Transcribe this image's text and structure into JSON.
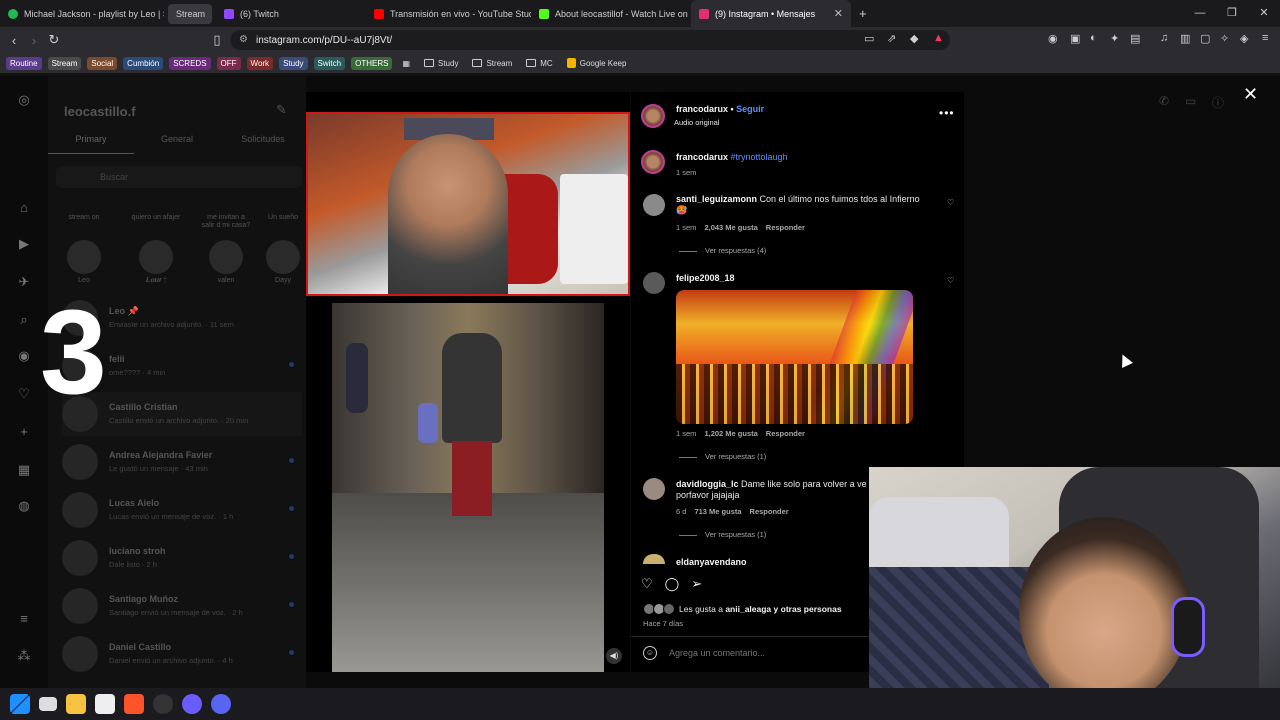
{
  "tabs": [
    {
      "title": "Michael Jackson - playlist by Leo | Sp",
      "color": "#1db954"
    },
    {
      "title": "Stream",
      "color": "#555555"
    },
    {
      "title": "(6) Twitch",
      "color": "#9146ff"
    },
    {
      "title": "Transmisión en vivo - YouTube Studio",
      "color": "#ff0000"
    },
    {
      "title": "About leocastillof - Watch Live on Ki",
      "color": "#53fc18"
    },
    {
      "title": "(9) Instagram • Mensajes",
      "color": "#e1306c"
    }
  ],
  "address": {
    "url": "instagram.com/p/DU--aU7j8Vt/"
  },
  "bookmarks": [
    {
      "label": "Routine",
      "color": "#5a3d8a"
    },
    {
      "label": "Stream",
      "color": "#4a4a4a"
    },
    {
      "label": "Social",
      "color": "#7a4a2a"
    },
    {
      "label": "Cumbión",
      "color": "#2a4a7a"
    },
    {
      "label": "SCREDS",
      "color": "#6a2a7a"
    },
    {
      "label": "OFF",
      "color": "#7a2a4a"
    },
    {
      "label": "Work",
      "color": "#7a2a2a"
    },
    {
      "label": "Study",
      "color": "#3a4a7a"
    },
    {
      "label": "Switch",
      "color": "#2a5a5a"
    },
    {
      "label": "OTHERS",
      "color": "#3a6a3a"
    }
  ],
  "bookmark_folders": [
    "Study",
    "Stream",
    "MC",
    "Google Keep"
  ],
  "dm": {
    "username": "leocastillo.f",
    "tabs": [
      "Primary",
      "General",
      "Solicitudes"
    ],
    "search_placeholder": "Buscar",
    "notes": [
      {
        "bubble": "stream on",
        "name": "Leo"
      },
      {
        "bubble": "quiero un afajer",
        "name": "𝑳𝒐𝒖𝒓 🕯"
      },
      {
        "bubble": "me invitan a salir d mi casa?",
        "name": "valen"
      },
      {
        "bubble": "Un sueño",
        "name": "Dayy"
      }
    ],
    "chats": [
      {
        "name": "Leo 📌",
        "msg": "Enviaste un archivo adjunto. · 11 sem"
      },
      {
        "name": "felii",
        "msg": "ome???? · 4 min"
      },
      {
        "name": "Castillo Cristian",
        "msg": "Castillo envió un archivo adjunto. · 20 min"
      },
      {
        "name": "Andrea Alejandra Favier",
        "msg": "Le gustó un mensaje · 43 min"
      },
      {
        "name": "Lucas Aielo",
        "msg": "Lucas envió un mensaje de voz. · 1 h"
      },
      {
        "name": "luciano stroh",
        "msg": "Dale listo · 2 h"
      },
      {
        "name": "Santiago Muñoz",
        "msg": "Santiago envió un mensaje de voz. · 2 h"
      },
      {
        "name": "Daniel Castillo",
        "msg": "Daniel envió un archivo adjunto. · 4 h"
      }
    ]
  },
  "overlay_number": "3",
  "post": {
    "author": "francodarux",
    "follow": "Seguir",
    "audio": "Audio original",
    "caption_user": "francodarux",
    "caption_tag": "#trynottolaugh",
    "caption_time": "1 sem",
    "comments": [
      {
        "user": "santi_leguizamonn",
        "text": "Con el último nos fuimos tdos al Infierno 🥵",
        "time": "1 sem",
        "likes": "2,043 Me gusta",
        "reply": "Responder",
        "replies": "Ver respuestas (4)"
      },
      {
        "user": "felipe2008_18",
        "text": "",
        "time": "1 sem",
        "likes": "1,202 Me gusta",
        "reply": "Responder",
        "replies": "Ver respuestas (1)"
      },
      {
        "user": "davidloggia_lc",
        "text": "Dame like solo para volver a ve porfavor jajajaja",
        "time": "6 d",
        "likes": "713 Me gusta",
        "reply": "Responder",
        "replies": "Ver respuestas (1)"
      },
      {
        "user": "eldanyavendano",
        "text": ""
      }
    ],
    "liked_by_prefix": "Les gusta a",
    "liked_by_user": "anii_aleaga",
    "liked_by_suffix": "y otras personas",
    "posted_ago": "Hace 7 días",
    "comment_placeholder": "Agrega un comentario..."
  }
}
